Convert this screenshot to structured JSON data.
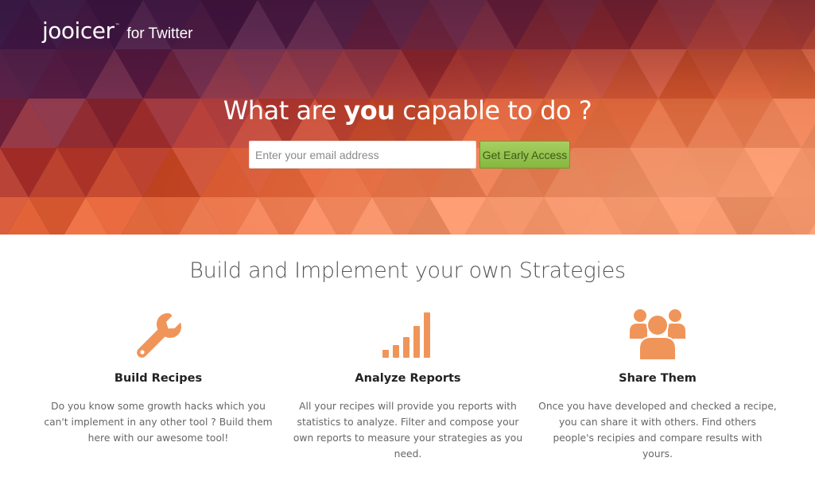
{
  "brand": {
    "logo_text": "jooicer",
    "trademark": "™",
    "suffix": "for Twitter"
  },
  "hero": {
    "title_before": "What are ",
    "title_emphasis": "you",
    "title_after": " capable to do ?",
    "email_placeholder": "Enter your email address",
    "email_value": "",
    "cta_label": "Get Early Access"
  },
  "features_section": {
    "title": "Build and Implement your own Strategies",
    "items": [
      {
        "icon": "wrench-icon",
        "title": "Build Recipes",
        "text": "Do you know some growth hacks which you can't implement in any other tool ? Build them here with our awesome tool!"
      },
      {
        "icon": "bar-chart-icon",
        "title": "Analyze Reports",
        "text": "All your recipes will provide you reports with statistics to analyze. Filter and compose your own reports to measure your strategies as you need."
      },
      {
        "icon": "users-group-icon",
        "title": "Share Them",
        "text": "Once you have developed and checked a recipe, you can share it with others. Find others people's recipies and compare results with yours."
      }
    ]
  },
  "colors": {
    "accent": "#f0955a",
    "cta_green": "#95c34f",
    "hero_dark": "#3b1f4d",
    "hero_orange": "#dc5b2e"
  }
}
